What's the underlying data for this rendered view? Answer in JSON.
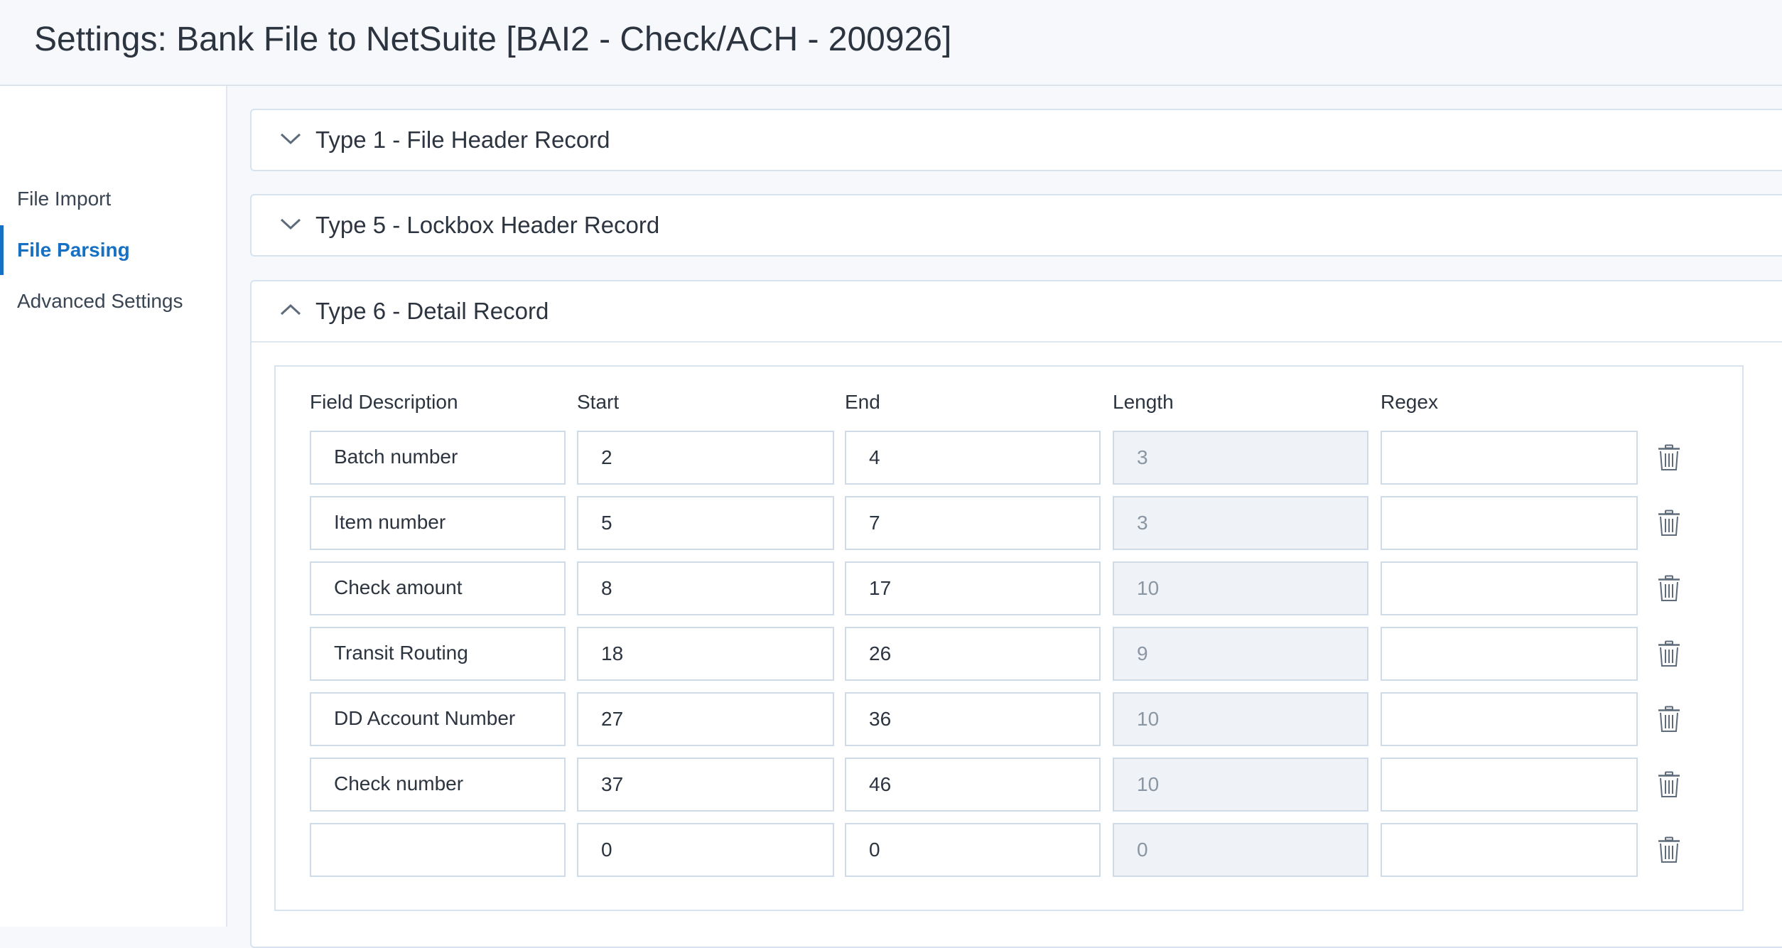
{
  "header": {
    "title": "Settings: Bank File to NetSuite [BAI2 - Check/ACH - 200926]"
  },
  "sidebar": {
    "items": [
      {
        "label": "File Import"
      },
      {
        "label": "File Parsing"
      },
      {
        "label": "Advanced Settings"
      }
    ],
    "active": "File Parsing"
  },
  "sections": [
    {
      "title": "Type 1 - File Header Record",
      "expanded": false
    },
    {
      "title": "Type 5 - Lockbox Header Record",
      "expanded": false
    },
    {
      "title": "Type 6 - Detail Record",
      "expanded": true
    }
  ],
  "detail_table": {
    "columns": [
      "Field Description",
      "Start",
      "End",
      "Length",
      "Regex"
    ],
    "rows": [
      {
        "description": "Batch number",
        "start": "2",
        "end": "4",
        "length": "3",
        "regex": ""
      },
      {
        "description": "Item number",
        "start": "5",
        "end": "7",
        "length": "3",
        "regex": ""
      },
      {
        "description": "Check amount",
        "start": "8",
        "end": "17",
        "length": "10",
        "regex": ""
      },
      {
        "description": "Transit Routing",
        "start": "18",
        "end": "26",
        "length": "9",
        "regex": ""
      },
      {
        "description": "DD Account Number",
        "start": "27",
        "end": "36",
        "length": "10",
        "regex": ""
      },
      {
        "description": "Check number",
        "start": "37",
        "end": "46",
        "length": "10",
        "regex": ""
      },
      {
        "description": "",
        "start": "0",
        "end": "0",
        "length": "0",
        "regex": ""
      }
    ]
  },
  "icons": {
    "collapsed": "chevron-down-icon",
    "expanded": "chevron-up-icon",
    "delete": "trash-icon"
  },
  "colors": {
    "accent": "#1670c4",
    "border": "#d7e3ef",
    "readonly_bg": "#eff3f7"
  }
}
